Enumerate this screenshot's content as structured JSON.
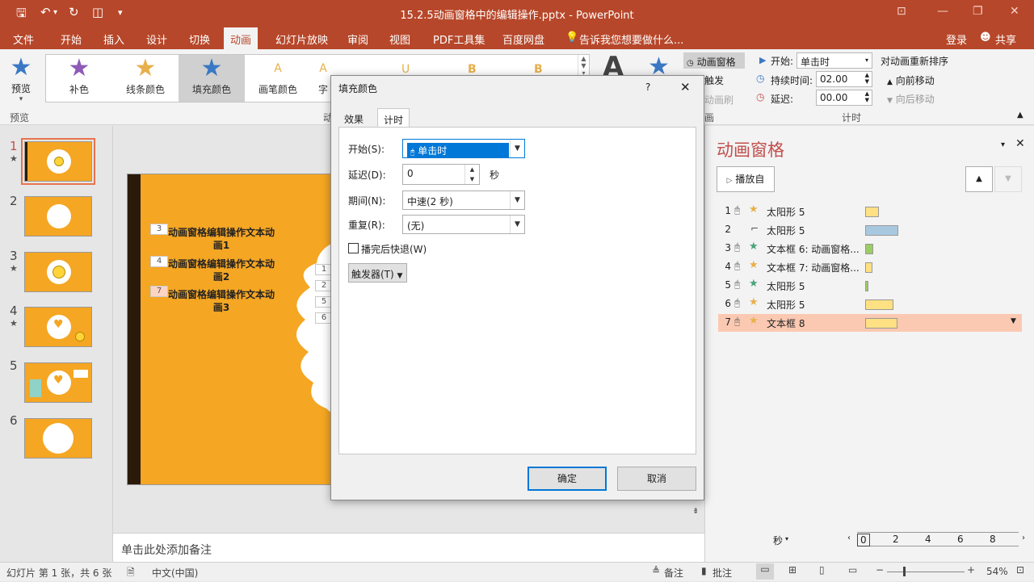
{
  "window": {
    "title": "15.2.5动画窗格中的编辑操作.pptx - PowerPoint",
    "minimize": "—",
    "restore": "❐",
    "close": "✕",
    "ribbon_opts": "⊡"
  },
  "tabs": [
    "文件",
    "开始",
    "插入",
    "设计",
    "切换",
    "动画",
    "幻灯片放映",
    "审阅",
    "视图",
    "PDF工具集",
    "百度网盘"
  ],
  "tell_me": "告诉我您想要做什么...",
  "account": {
    "login": "登录",
    "share": "共享"
  },
  "ribbon": {
    "preview_label": "预览",
    "preview_group": "预览",
    "gallery": [
      "补色",
      "线条颜色",
      "填充颜色",
      "画笔颜色",
      "字"
    ],
    "gallery_letters": [
      "A",
      "A",
      "U",
      "B",
      "B"
    ],
    "anim_group_fragment": "动",
    "anim_pane_btn": "动画窗格",
    "trigger_btn": "触发",
    "painter_btn": "动画刷",
    "adv_group_fragment": "画",
    "start_label": "开始:",
    "start_value": "单击时",
    "duration_label": "持续时间:",
    "duration_value": "02.00",
    "delay_label": "延迟:",
    "delay_value": "00.00",
    "reorder_label": "对动画重新排序",
    "move_earlier": "向前移动",
    "move_later": "向后移动",
    "timing_group": "计时"
  },
  "thumbs": [
    {
      "num": "1",
      "star": "★"
    },
    {
      "num": "2",
      "star": ""
    },
    {
      "num": "3",
      "star": "★"
    },
    {
      "num": "4",
      "star": "★"
    },
    {
      "num": "5",
      "star": ""
    },
    {
      "num": "6",
      "star": ""
    }
  ],
  "slide": {
    "items": [
      {
        "seq": "3",
        "text": "动画窗格编辑操作文本动画1"
      },
      {
        "seq": "4",
        "text": "动画窗格编辑操作文本动画2"
      },
      {
        "seq": "7",
        "text": "动画窗格编辑操作文本动画3"
      }
    ],
    "right_seq": [
      "1",
      "2",
      "5",
      "6"
    ]
  },
  "notes": "单击此处添加备注",
  "anim_pane": {
    "title": "动画窗格",
    "play_from": "播放自",
    "rows": [
      {
        "n": "1",
        "name": "太阳形 5",
        "color": "#ffe082"
      },
      {
        "n": "2",
        "name": "太阳形 5",
        "color": "#a8c8e0"
      },
      {
        "n": "3",
        "name": "文本框 6: 动画窗格...",
        "color": "#9ccc65"
      },
      {
        "n": "4",
        "name": "文本框 7: 动画窗格...",
        "color": "#ffe082"
      },
      {
        "n": "5",
        "name": "太阳形 5",
        "color": "#9ccc65"
      },
      {
        "n": "6",
        "name": "太阳形 5",
        "color": "#ffe082"
      },
      {
        "n": "7",
        "name": "文本框 8",
        "color": "#ffe082"
      }
    ],
    "seconds": "秒",
    "timeline": [
      "0",
      "2",
      "4",
      "6",
      "8"
    ]
  },
  "dialog": {
    "title": "填充颜色",
    "help": "?",
    "close": "✕",
    "tabs": [
      "效果",
      "计时"
    ],
    "start_label": "开始(S):",
    "start_value": "单击时",
    "delay_label": "延迟(D):",
    "delay_value": "0",
    "delay_unit": "秒",
    "duration_label": "期间(N):",
    "duration_value": "中速(2 秒)",
    "repeat_label": "重复(R):",
    "repeat_value": "(无)",
    "rewind_label": "播完后快退(W)",
    "trigger_btn": "触发器(T)",
    "ok": "确定",
    "cancel": "取消"
  },
  "status": {
    "slide_info": "幻灯片 第 1 张，共 6 张",
    "language": "中文(中国)",
    "notes": "备注",
    "comments": "批注",
    "zoom": "54%"
  }
}
